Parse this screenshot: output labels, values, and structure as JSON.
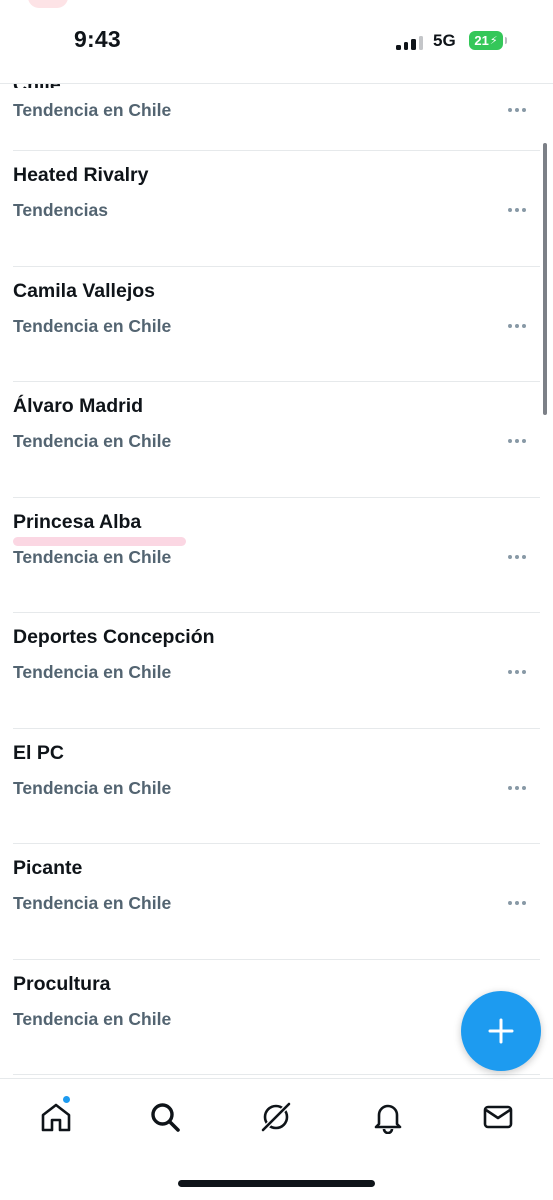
{
  "status_bar": {
    "time": "9:43",
    "network": "5G",
    "battery": "21"
  },
  "trends": [
    {
      "title": "Chile",
      "subtitle": "Tendencia en Chile",
      "partial": true
    },
    {
      "title": "Heated Rivalry",
      "subtitle": "Tendencias"
    },
    {
      "title": "Camila Vallejos",
      "subtitle": "Tendencia en Chile"
    },
    {
      "title": "Álvaro Madrid",
      "subtitle": "Tendencia en Chile"
    },
    {
      "title": "Princesa Alba",
      "subtitle": "Tendencia en Chile"
    },
    {
      "title": "Deportes Concepción",
      "subtitle": "Tendencia en Chile"
    },
    {
      "title": "El PC",
      "subtitle": "Tendencia en Chile"
    },
    {
      "title": "Picante",
      "subtitle": "Tendencia en Chile"
    },
    {
      "title": "Procultura",
      "subtitle": "Tendencia en Chile"
    }
  ],
  "fab": {
    "icon": "plus-icon",
    "color": "#1d9bf0"
  },
  "bottom_nav": [
    {
      "icon": "home-icon",
      "active": true,
      "badge": true
    },
    {
      "icon": "search-icon"
    },
    {
      "icon": "grok-icon"
    },
    {
      "icon": "bell-icon"
    },
    {
      "icon": "mail-icon"
    }
  ],
  "colors": {
    "accent": "#1d9bf0",
    "title_text": "#0f1419",
    "secondary_text": "#536471",
    "divider": "#e6e9eb",
    "battery": "#34c759"
  }
}
